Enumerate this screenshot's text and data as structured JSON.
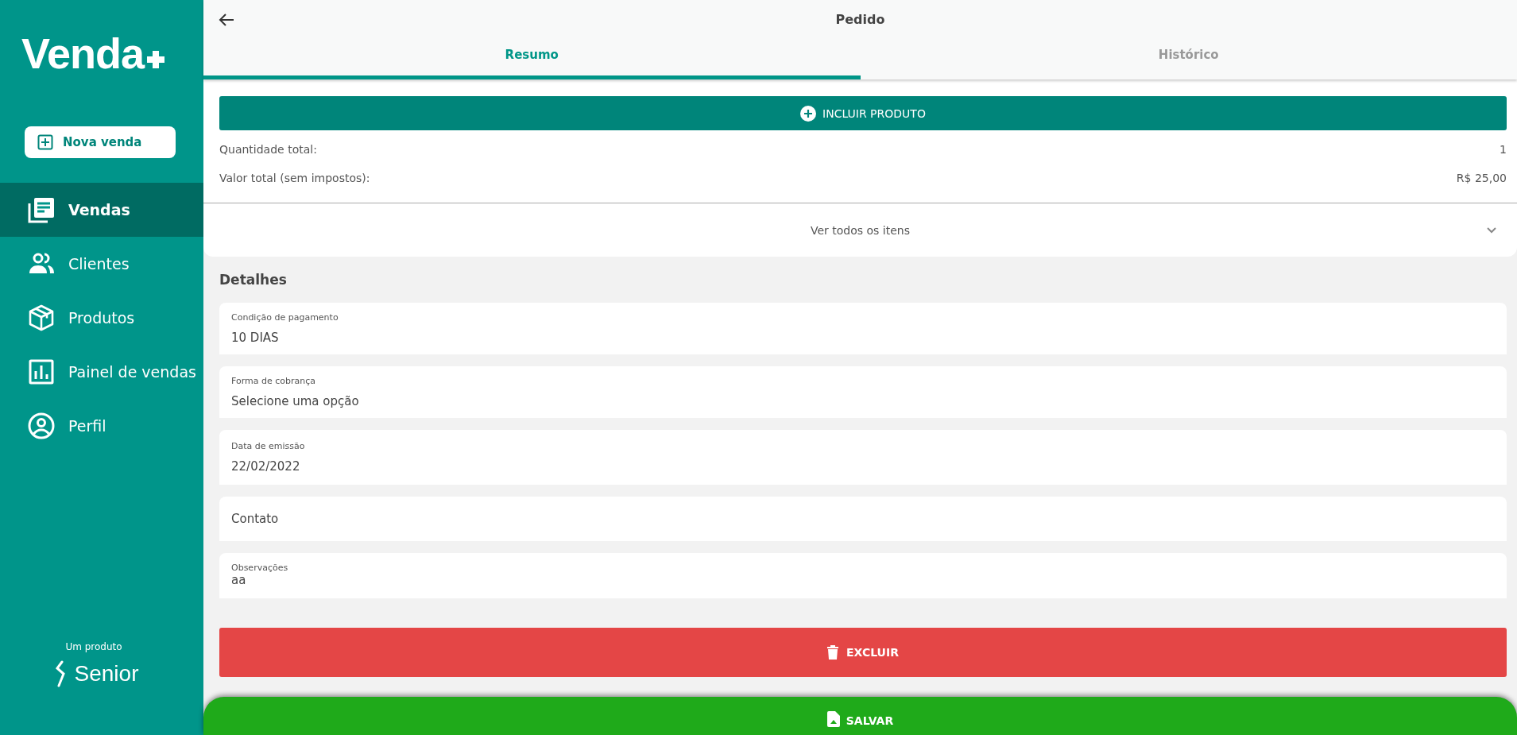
{
  "sidebar": {
    "logo": "Venda",
    "new_sale_button": "Nova venda",
    "items": [
      {
        "label": "Vendas",
        "kind": "documents",
        "selected": true
      },
      {
        "label": "Clientes",
        "kind": "people",
        "selected": false
      },
      {
        "label": "Produtos",
        "kind": "box",
        "selected": false
      },
      {
        "label": "Painel de vendas",
        "kind": "chart",
        "selected": false
      },
      {
        "label": "Perfil",
        "kind": "profile",
        "selected": false
      }
    ],
    "footer_caption": "Um produto",
    "footer_brand": "Senior"
  },
  "header": {
    "title": "Pedido",
    "tabs": [
      {
        "label": "Resumo",
        "selected": true
      },
      {
        "label": "Histórico",
        "selected": false
      }
    ]
  },
  "items_section": {
    "add_button": "INCLUIR PRODUTO",
    "totals": [
      {
        "label": "Quantidade total:",
        "value": "1"
      },
      {
        "label": "Valor total (sem impostos):",
        "value": "R$ 25,00"
      }
    ],
    "expand_link": "Ver todos os itens"
  },
  "details": {
    "title": "Detalhes",
    "fields": [
      {
        "label": "Condição de pagamento",
        "value": "10 DIAS"
      },
      {
        "label": "Forma de cobrança",
        "placeholder": "Selecione uma opção"
      },
      {
        "label": "Data de emissão",
        "value": "22/02/2022"
      },
      {
        "placeholder": "Contato"
      },
      {
        "label": "Observações",
        "value": "aa",
        "kind": "textarea"
      }
    ]
  },
  "delete_button": "EXCLUIR",
  "save_button": "SALVAR"
}
